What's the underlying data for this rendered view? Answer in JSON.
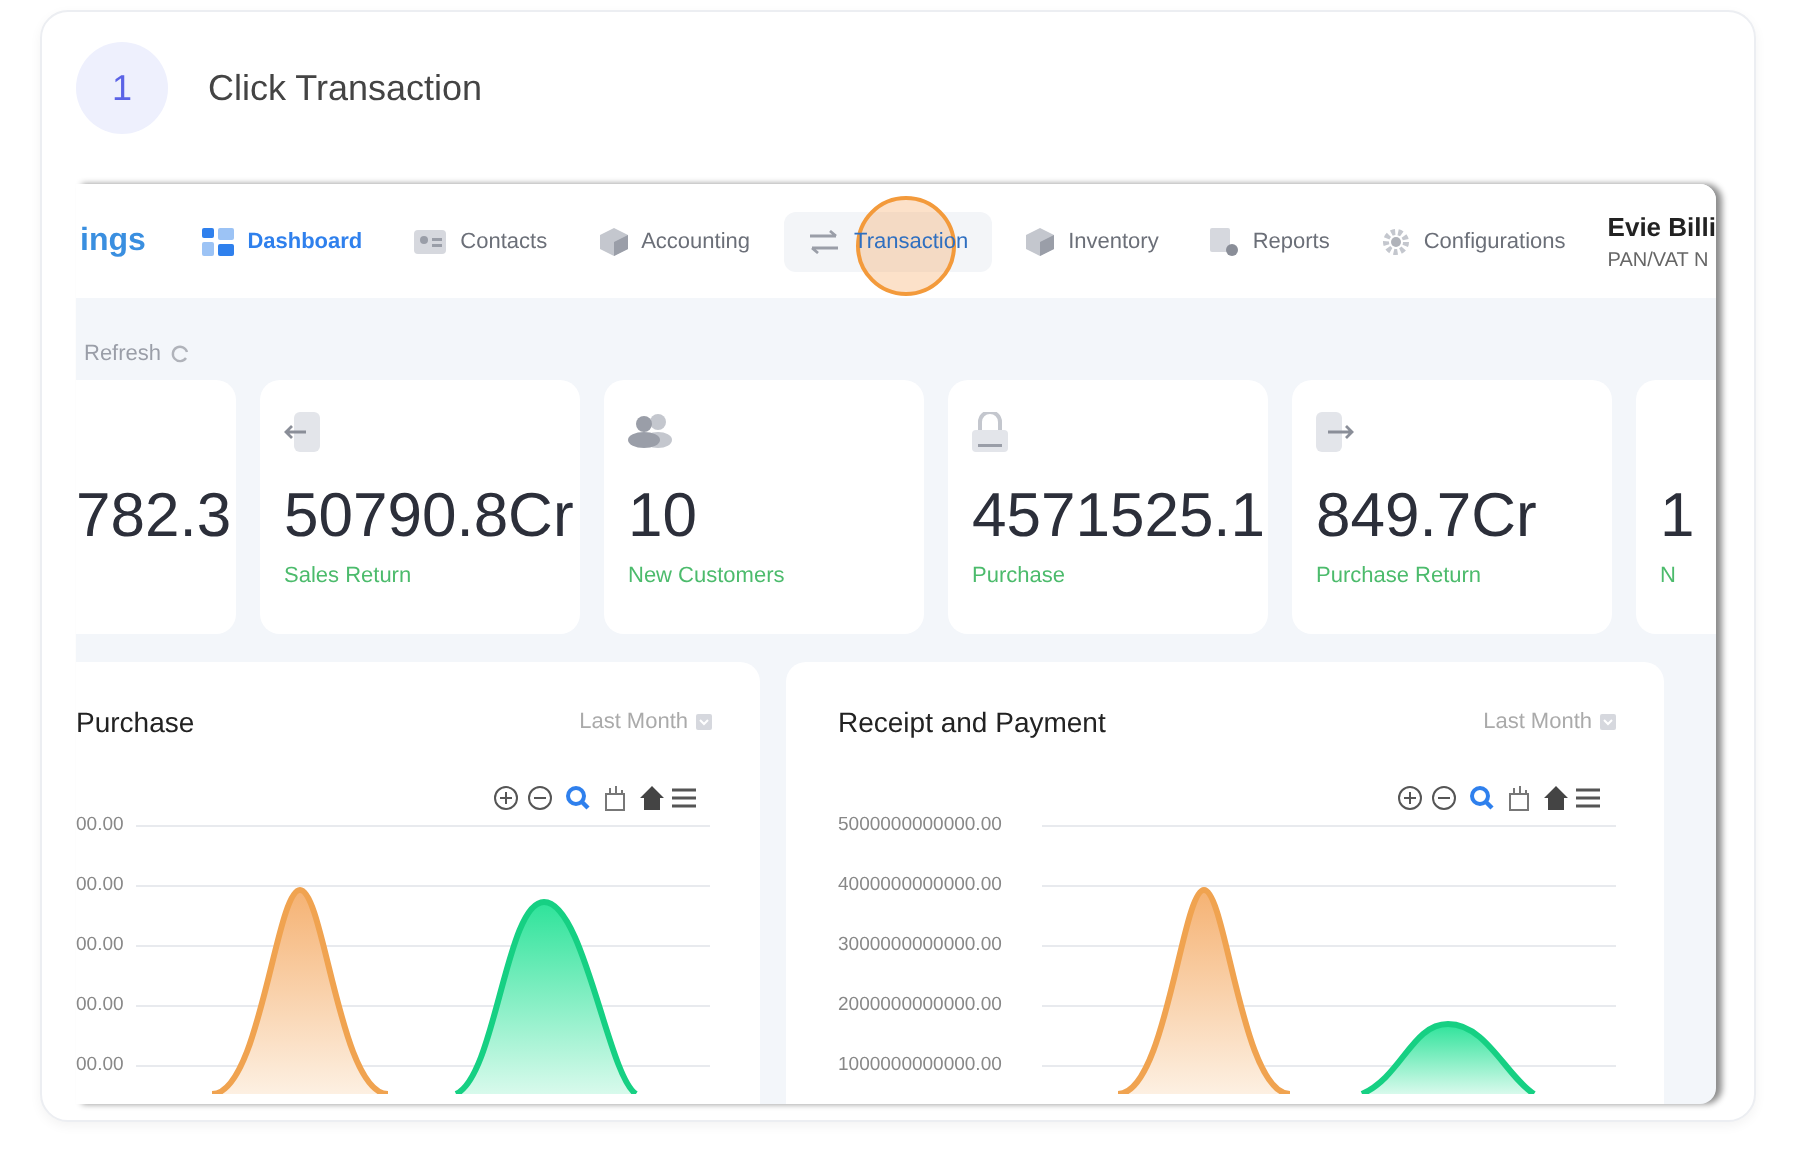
{
  "step": {
    "number": "1",
    "instruction": "Click Transaction"
  },
  "app": {
    "logo_text": "ings",
    "nav": [
      {
        "label": "Dashboard",
        "selected": true,
        "clicked": false
      },
      {
        "label": "Contacts",
        "selected": false,
        "clicked": false
      },
      {
        "label": "Accounting",
        "selected": false,
        "clicked": false
      },
      {
        "label": "Transaction",
        "selected": false,
        "clicked": true
      },
      {
        "label": "Inventory",
        "selected": false,
        "clicked": false
      },
      {
        "label": "Reports",
        "selected": false,
        "clicked": false
      },
      {
        "label": "Configurations",
        "selected": false,
        "clicked": false
      }
    ],
    "user": {
      "name": "Evie Billi",
      "subtitle": "PAN/VAT N"
    },
    "refresh": "Refresh",
    "stats": [
      {
        "kind": "cut-left",
        "value": "782.3"
      },
      {
        "kind": "full",
        "value": "50790.8Cr",
        "label": "Sales Return"
      },
      {
        "kind": "full",
        "value": "10",
        "label": "New Customers"
      },
      {
        "kind": "full",
        "value": "4571525.1",
        "label": "Purchase"
      },
      {
        "kind": "full",
        "value": "849.7Cr",
        "label": "Purchase Return"
      },
      {
        "kind": "cut-right",
        "value": "1",
        "label": "N"
      }
    ],
    "charts": [
      {
        "title": "Purchase",
        "period": "Last Month",
        "y_labels": [
          "00.00",
          "00.00",
          "00.00",
          "00.00",
          "00.00"
        ]
      },
      {
        "title": "Receipt and Payment",
        "period": "Last Month",
        "y_labels": [
          "5000000000000.00",
          "4000000000000.00",
          "3000000000000.00",
          "2000000000000.00",
          "1000000000000.00"
        ]
      }
    ]
  }
}
